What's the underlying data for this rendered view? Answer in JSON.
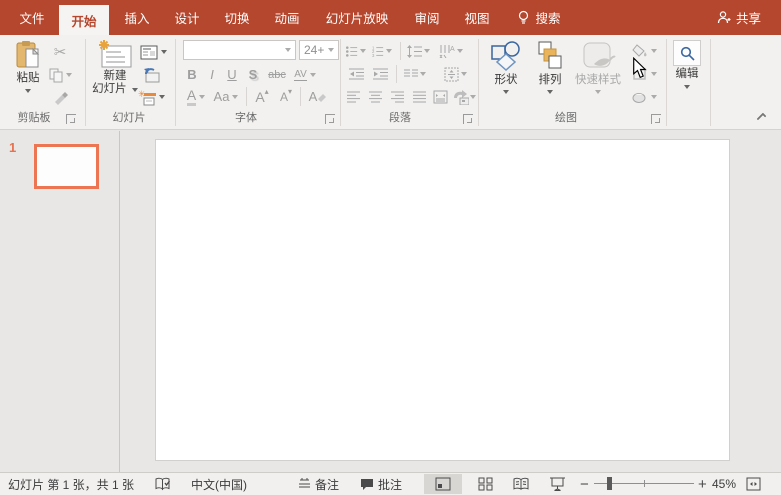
{
  "titlebar": {
    "tabs": [
      "文件",
      "开始",
      "插入",
      "设计",
      "切换",
      "动画",
      "幻灯片放映",
      "审阅",
      "视图"
    ],
    "search_label": "搜索",
    "share_label": "共享"
  },
  "ribbon": {
    "clipboard": {
      "group_label": "剪贴板",
      "paste_label": "粘贴"
    },
    "slides": {
      "group_label": "幻灯片",
      "new_slide_line1": "新建",
      "new_slide_line2": "幻灯片"
    },
    "font": {
      "group_label": "字体",
      "font_name_value": "",
      "font_size_value": "24+",
      "buttons": {
        "bold": "B",
        "italic": "I",
        "underline": "U",
        "shadow": "S",
        "strikethrough": "abc",
        "char_spacing": "AV",
        "font_color": "A",
        "change_case": "Aa",
        "increase_size": "A",
        "decrease_size": "A",
        "clear_format": "A"
      }
    },
    "paragraph": {
      "group_label": "段落"
    },
    "drawing": {
      "group_label": "绘图",
      "shapes_label": "形状",
      "arrange_label": "排列",
      "quick_styles_label": "快速样式"
    },
    "editing": {
      "label": "编辑"
    }
  },
  "slide_panel": {
    "slide_number": "1"
  },
  "statusbar": {
    "slide_info": "幻灯片 第 1 张，共 1 张",
    "language": "中文(中国)",
    "notes_label": "备注",
    "comments_label": "批注",
    "zoom_level": "45%"
  },
  "colors": {
    "titlebar_red": "#B5472E",
    "active_tab_text": "#B5472E",
    "thumbnail_border": "#ED7551",
    "shapes_icon_blue": "#3A66A0",
    "arrange_icon_orange": "#E9B45C",
    "clipboard_icon_tan": "#E3B86E"
  }
}
